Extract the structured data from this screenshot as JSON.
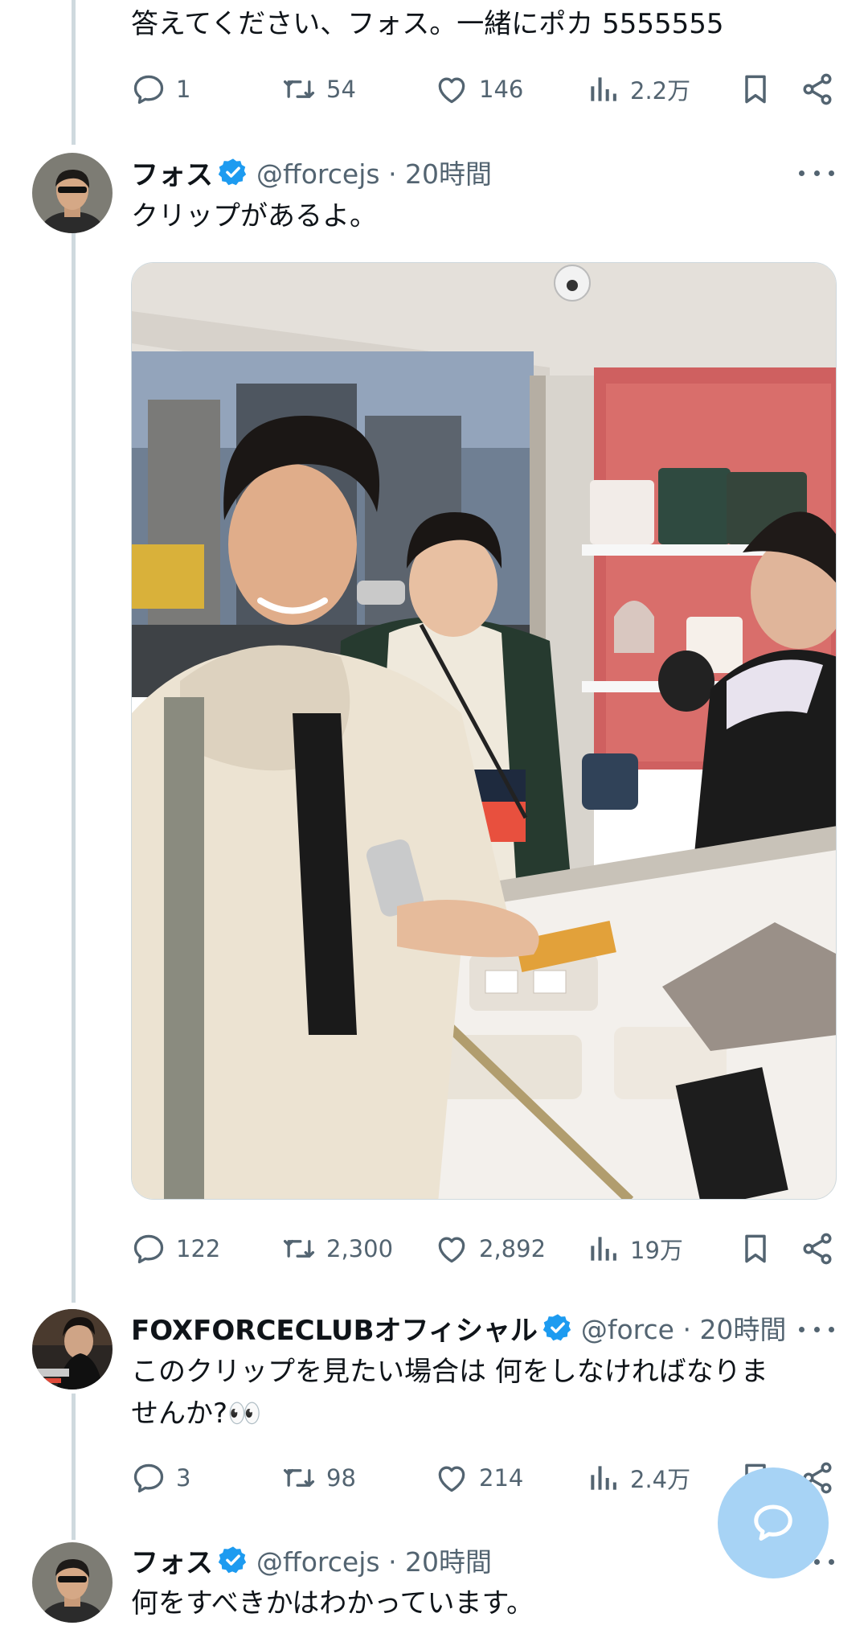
{
  "tweets": [
    {
      "text": "答えてください、フォス。一緒にポカ 5555555",
      "actions": {
        "replies": "1",
        "retweets": "54",
        "likes": "146",
        "views": "2.2万"
      }
    },
    {
      "name": "フォス",
      "handle": "@fforcejs · 20時間",
      "text": "クリップがあるよ。",
      "actions": {
        "replies": "122",
        "retweets": "2,300",
        "likes": "2,892",
        "views": "19万"
      }
    },
    {
      "name": "FOXFORCECLUBオフィシャル",
      "handle": "@force · 20時間",
      "text_line1": "このクリップを見たい場合は 何をしなければなりま",
      "text_line2": "せんか?👀",
      "actions": {
        "replies": "3",
        "retweets": "98",
        "likes": "214",
        "views": "2.4万"
      }
    },
    {
      "name": "フォス",
      "handle": "@fforcejs · 20時間",
      "text": "何をすべきかはわかっています。"
    }
  ],
  "icons": {
    "reply": "speech-bubble-icon",
    "retweet": "retweet-icon",
    "like": "heart-icon",
    "views": "bar-chart-icon",
    "bookmark": "bookmark-icon",
    "share": "share-icon",
    "verified": "verified-badge-icon",
    "fab": "compose-message-icon"
  },
  "colors": {
    "verified": "#1d9bf0",
    "muted": "#536471",
    "fab": "#a7d3f5"
  }
}
